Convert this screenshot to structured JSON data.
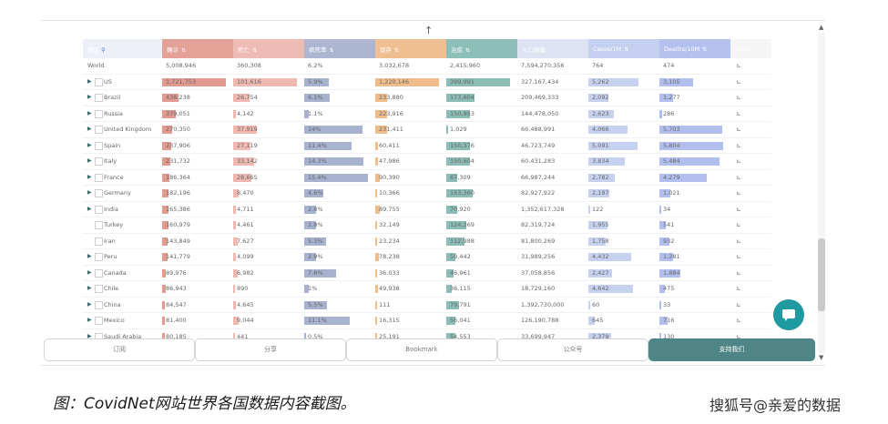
{
  "header_cols": [
    {
      "label": "地区",
      "icon": "search-icon"
    },
    {
      "label": "确诊"
    },
    {
      "label": "死亡"
    },
    {
      "label": "病死率"
    },
    {
      "label": "现存"
    },
    {
      "label": "治愈"
    },
    {
      "label": "人口数量"
    },
    {
      "label": "Cases/1M"
    },
    {
      "label": "Deaths/10M"
    },
    {
      "label": "More"
    }
  ],
  "max": {
    "confirmed": 1721753,
    "deaths": 101616,
    "cfr": 15.4,
    "active": 1220146,
    "recovered": 399991,
    "cases_1m": 6642,
    "deaths_10m": 5804
  },
  "colors": {
    "confirmed": "#e19a90",
    "deaths": "#efb8b1",
    "cfr": "#a7b2cf",
    "active": "#efbc8c",
    "recovered": "#8bbdb6",
    "cases_1m": "#c6d1f0",
    "deaths_10m": "#b2bfee"
  },
  "rows": [
    {
      "country": "World",
      "expand": false,
      "check": false,
      "confirmed": "5,008,946",
      "deaths": "360,308",
      "cfr": "6.2%",
      "active": "3,032,678",
      "recovered": "2,415,960",
      "pop": "7,594,270,356",
      "cases_1m": "764",
      "deaths_10m": "474",
      "bars": false
    },
    {
      "country": "US",
      "expand": true,
      "check": true,
      "confirmed": "1,721,753",
      "deaths": "101,616",
      "cfr": "5.9%",
      "active": "1,220,146",
      "recovered": "399,991",
      "pop": "327,167,434",
      "cases_1m": "5,262",
      "deaths_10m": "3,105",
      "bars": true,
      "v": {
        "confirmed": 1721753,
        "deaths": 101616,
        "cfr": 5.9,
        "active": 1220146,
        "recovered": 399991,
        "cases_1m": 5262,
        "deaths_10m": 3105
      }
    },
    {
      "country": "Brazil",
      "expand": true,
      "check": true,
      "confirmed": "438,238",
      "deaths": "26,754",
      "cfr": "6.1%",
      "active": "233,880",
      "recovered": "177,604",
      "pop": "209,469,333",
      "cases_1m": "2,092",
      "deaths_10m": "1,277",
      "bars": true,
      "v": {
        "confirmed": 438238,
        "deaths": 26754,
        "cfr": 6.1,
        "active": 233880,
        "recovered": 177604,
        "cases_1m": 2092,
        "deaths_10m": 1277
      }
    },
    {
      "country": "Russia",
      "expand": true,
      "check": true,
      "confirmed": "379,051",
      "deaths": "4,142",
      "cfr": "1.1%",
      "active": "223,916",
      "recovered": "150,993",
      "pop": "144,478,050",
      "cases_1m": "2,623",
      "deaths_10m": "286",
      "bars": true,
      "v": {
        "confirmed": 379051,
        "deaths": 4142,
        "cfr": 1.1,
        "active": 223916,
        "recovered": 150993,
        "cases_1m": 2623,
        "deaths_10m": 286
      }
    },
    {
      "country": "United Kingdom",
      "expand": true,
      "check": true,
      "confirmed": "270,350",
      "deaths": "37,919",
      "cfr": "14%",
      "active": "231,411",
      "recovered": "1,029",
      "pop": "66,488,991",
      "cases_1m": "4,066",
      "deaths_10m": "5,703",
      "bars": true,
      "v": {
        "confirmed": 270350,
        "deaths": 37919,
        "cfr": 14,
        "active": 231411,
        "recovered": 1029,
        "cases_1m": 4066,
        "deaths_10m": 5703
      }
    },
    {
      "country": "Spain",
      "expand": true,
      "check": true,
      "confirmed": "237,906",
      "deaths": "27,119",
      "cfr": "11.4%",
      "active": "60,411",
      "recovered": "150,376",
      "pop": "46,723,749",
      "cases_1m": "5,091",
      "deaths_10m": "5,804",
      "bars": true,
      "v": {
        "confirmed": 237906,
        "deaths": 27119,
        "cfr": 11.4,
        "active": 60411,
        "recovered": 150376,
        "cases_1m": 5091,
        "deaths_10m": 5804
      }
    },
    {
      "country": "Italy",
      "expand": true,
      "check": true,
      "confirmed": "231,732",
      "deaths": "33,142",
      "cfr": "14.3%",
      "active": "47,986",
      "recovered": "150,604",
      "pop": "60,431,283",
      "cases_1m": "3,834",
      "deaths_10m": "5,484",
      "bars": true,
      "v": {
        "confirmed": 231732,
        "deaths": 33142,
        "cfr": 14.3,
        "active": 47986,
        "recovered": 150604,
        "cases_1m": 3834,
        "deaths_10m": 5484
      }
    },
    {
      "country": "France",
      "expand": true,
      "check": true,
      "confirmed": "186,364",
      "deaths": "28,665",
      "cfr": "15.4%",
      "active": "90,390",
      "recovered": "67,309",
      "pop": "66,987,244",
      "cases_1m": "2,782",
      "deaths_10m": "4,279",
      "bars": true,
      "v": {
        "confirmed": 186364,
        "deaths": 28665,
        "cfr": 15.4,
        "active": 90390,
        "recovered": 67309,
        "cases_1m": 2782,
        "deaths_10m": 4279
      }
    },
    {
      "country": "Germany",
      "expand": true,
      "check": true,
      "confirmed": "182,196",
      "deaths": "8,470",
      "cfr": "4.6%",
      "active": "10,366",
      "recovered": "163,360",
      "pop": "82,927,922",
      "cases_1m": "2,197",
      "deaths_10m": "1,021",
      "bars": true,
      "v": {
        "confirmed": 182196,
        "deaths": 8470,
        "cfr": 4.6,
        "active": 10366,
        "recovered": 163360,
        "cases_1m": 2197,
        "deaths_10m": 1021
      }
    },
    {
      "country": "India",
      "expand": true,
      "check": true,
      "confirmed": "165,386",
      "deaths": "4,711",
      "cfr": "2.8%",
      "active": "89,755",
      "recovered": "70,920",
      "pop": "1,352,617,328",
      "cases_1m": "122",
      "deaths_10m": "34",
      "bars": true,
      "v": {
        "confirmed": 165386,
        "deaths": 4711,
        "cfr": 2.8,
        "active": 89755,
        "recovered": 70920,
        "cases_1m": 122,
        "deaths_10m": 34
      }
    },
    {
      "country": "Turkey",
      "expand": false,
      "check": true,
      "confirmed": "160,979",
      "deaths": "4,461",
      "cfr": "2.8%",
      "active": "32,149",
      "recovered": "124,369",
      "pop": "82,319,724",
      "cases_1m": "1,955",
      "deaths_10m": "541",
      "bars": true,
      "v": {
        "confirmed": 160979,
        "deaths": 4461,
        "cfr": 2.8,
        "active": 32149,
        "recovered": 124369,
        "cases_1m": 1955,
        "deaths_10m": 541
      }
    },
    {
      "country": "Iran",
      "expand": false,
      "check": true,
      "confirmed": "143,849",
      "deaths": "7,627",
      "cfr": "5.3%",
      "active": "23,234",
      "recovered": "112,988",
      "pop": "81,800,269",
      "cases_1m": "1,758",
      "deaths_10m": "932",
      "bars": true,
      "v": {
        "confirmed": 143849,
        "deaths": 7627,
        "cfr": 5.3,
        "active": 23234,
        "recovered": 112988,
        "cases_1m": 1758,
        "deaths_10m": 932
      }
    },
    {
      "country": "Peru",
      "expand": true,
      "check": true,
      "confirmed": "141,779",
      "deaths": "4,099",
      "cfr": "2.9%",
      "active": "78,238",
      "recovered": "59,442",
      "pop": "31,989,256",
      "cases_1m": "4,432",
      "deaths_10m": "1,281",
      "bars": true,
      "v": {
        "confirmed": 141779,
        "deaths": 4099,
        "cfr": 2.9,
        "active": 78238,
        "recovered": 59442,
        "cases_1m": 4432,
        "deaths_10m": 1281
      }
    },
    {
      "country": "Canada",
      "expand": true,
      "check": true,
      "confirmed": "89,976",
      "deaths": "6,982",
      "cfr": "7.8%",
      "active": "36,033",
      "recovered": "46,961",
      "pop": "37,058,856",
      "cases_1m": "2,427",
      "deaths_10m": "1,884",
      "bars": true,
      "v": {
        "confirmed": 89976,
        "deaths": 6982,
        "cfr": 7.8,
        "active": 36033,
        "recovered": 46961,
        "cases_1m": 2427,
        "deaths_10m": 1884
      }
    },
    {
      "country": "Chile",
      "expand": true,
      "check": true,
      "confirmed": "86,943",
      "deaths": "890",
      "cfr": "1%",
      "active": "49,938",
      "recovered": "36,115",
      "pop": "18,729,160",
      "cases_1m": "4,642",
      "deaths_10m": "475",
      "bars": true,
      "v": {
        "confirmed": 86943,
        "deaths": 890,
        "cfr": 1,
        "active": 49938,
        "recovered": 36115,
        "cases_1m": 4642,
        "deaths_10m": 475
      }
    },
    {
      "country": "China",
      "expand": true,
      "check": true,
      "confirmed": "84,547",
      "deaths": "4,645",
      "cfr": "5.5%",
      "active": "111",
      "recovered": "79,791",
      "pop": "1,392,730,000",
      "cases_1m": "60",
      "deaths_10m": "33",
      "bars": true,
      "v": {
        "confirmed": 84547,
        "deaths": 4645,
        "cfr": 5.5,
        "active": 111,
        "recovered": 79791,
        "cases_1m": 60,
        "deaths_10m": 33
      }
    },
    {
      "country": "Mexico",
      "expand": true,
      "check": true,
      "confirmed": "81,400",
      "deaths": "9,044",
      "cfr": "11.1%",
      "active": "16,315",
      "recovered": "56,041",
      "pop": "126,190,788",
      "cases_1m": "645",
      "deaths_10m": "716",
      "bars": true,
      "v": {
        "confirmed": 81400,
        "deaths": 9044,
        "cfr": 11.1,
        "active": 16315,
        "recovered": 56041,
        "cases_1m": 645,
        "deaths_10m": 716
      }
    },
    {
      "country": "Saudi Arabia",
      "expand": true,
      "check": true,
      "confirmed": "80,185",
      "deaths": "441",
      "cfr": "0.5%",
      "active": "25,191",
      "recovered": "54,553",
      "pop": "33,699,947",
      "cases_1m": "2,379",
      "deaths_10m": "130",
      "bars": true,
      "v": {
        "confirmed": 80185,
        "deaths": 441,
        "cfr": 0.5,
        "active": 25191,
        "recovered": 54553,
        "cases_1m": 2379,
        "deaths_10m": 130
      }
    }
  ],
  "buttons": {
    "subscribe": "订阅",
    "share": "分享",
    "bookmark": "Bookmark",
    "official": "公众号",
    "support": "支持我们"
  },
  "caption": "图：CovidNet网站世界各国数据内容截图。",
  "watermark": "搜狐号@亲爱的数据"
}
